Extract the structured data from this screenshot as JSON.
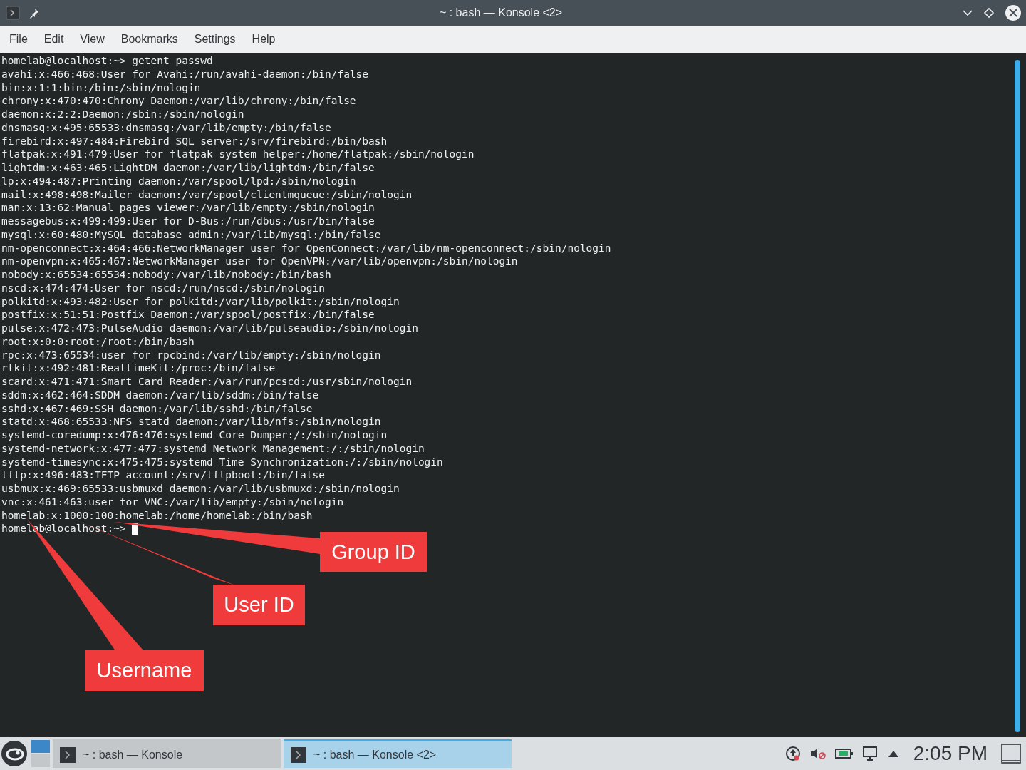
{
  "window": {
    "title": "~ : bash — Konsole <2>"
  },
  "menu": [
    "File",
    "Edit",
    "View",
    "Bookmarks",
    "Settings",
    "Help"
  ],
  "terminal": {
    "lines": [
      "homelab@localhost:~> getent passwd",
      "avahi:x:466:468:User for Avahi:/run/avahi-daemon:/bin/false",
      "bin:x:1:1:bin:/bin:/sbin/nologin",
      "chrony:x:470:470:Chrony Daemon:/var/lib/chrony:/bin/false",
      "daemon:x:2:2:Daemon:/sbin:/sbin/nologin",
      "dnsmasq:x:495:65533:dnsmasq:/var/lib/empty:/bin/false",
      "firebird:x:497:484:Firebird SQL server:/srv/firebird:/bin/bash",
      "flatpak:x:491:479:User for flatpak system helper:/home/flatpak:/sbin/nologin",
      "lightdm:x:463:465:LightDM daemon:/var/lib/lightdm:/bin/false",
      "lp:x:494:487:Printing daemon:/var/spool/lpd:/sbin/nologin",
      "mail:x:498:498:Mailer daemon:/var/spool/clientmqueue:/sbin/nologin",
      "man:x:13:62:Manual pages viewer:/var/lib/empty:/sbin/nologin",
      "messagebus:x:499:499:User for D-Bus:/run/dbus:/usr/bin/false",
      "mysql:x:60:480:MySQL database admin:/var/lib/mysql:/bin/false",
      "nm-openconnect:x:464:466:NetworkManager user for OpenConnect:/var/lib/nm-openconnect:/sbin/nologin",
      "nm-openvpn:x:465:467:NetworkManager user for OpenVPN:/var/lib/openvpn:/sbin/nologin",
      "nobody:x:65534:65534:nobody:/var/lib/nobody:/bin/bash",
      "nscd:x:474:474:User for nscd:/run/nscd:/sbin/nologin",
      "polkitd:x:493:482:User for polkitd:/var/lib/polkit:/sbin/nologin",
      "postfix:x:51:51:Postfix Daemon:/var/spool/postfix:/bin/false",
      "pulse:x:472:473:PulseAudio daemon:/var/lib/pulseaudio:/sbin/nologin",
      "root:x:0:0:root:/root:/bin/bash",
      "rpc:x:473:65534:user for rpcbind:/var/lib/empty:/sbin/nologin",
      "rtkit:x:492:481:RealtimeKit:/proc:/bin/false",
      "scard:x:471:471:Smart Card Reader:/var/run/pcscd:/usr/sbin/nologin",
      "sddm:x:462:464:SDDM daemon:/var/lib/sddm:/bin/false",
      "sshd:x:467:469:SSH daemon:/var/lib/sshd:/bin/false",
      "statd:x:468:65533:NFS statd daemon:/var/lib/nfs:/sbin/nologin",
      "systemd-coredump:x:476:476:systemd Core Dumper:/:/sbin/nologin",
      "systemd-network:x:477:477:systemd Network Management:/:/sbin/nologin",
      "systemd-timesync:x:475:475:systemd Time Synchronization:/:/sbin/nologin",
      "tftp:x:496:483:TFTP account:/srv/tftpboot:/bin/false",
      "usbmux:x:469:65533:usbmuxd daemon:/var/lib/usbmuxd:/sbin/nologin",
      "vnc:x:461:463:user for VNC:/var/lib/empty:/sbin/nologin",
      "homelab:x:1000:100:homelab:/home/homelab:/bin/bash",
      "homelab@localhost:~>"
    ]
  },
  "callouts": [
    {
      "label": "Group ID"
    },
    {
      "label": "User ID"
    },
    {
      "label": "Username"
    }
  ],
  "taskbar": {
    "tasks": [
      {
        "label": "~ : bash — Konsole",
        "selected": false
      },
      {
        "label": "~ : bash — Konsole <2>",
        "selected": true
      }
    ],
    "clock": "2:05 PM"
  }
}
